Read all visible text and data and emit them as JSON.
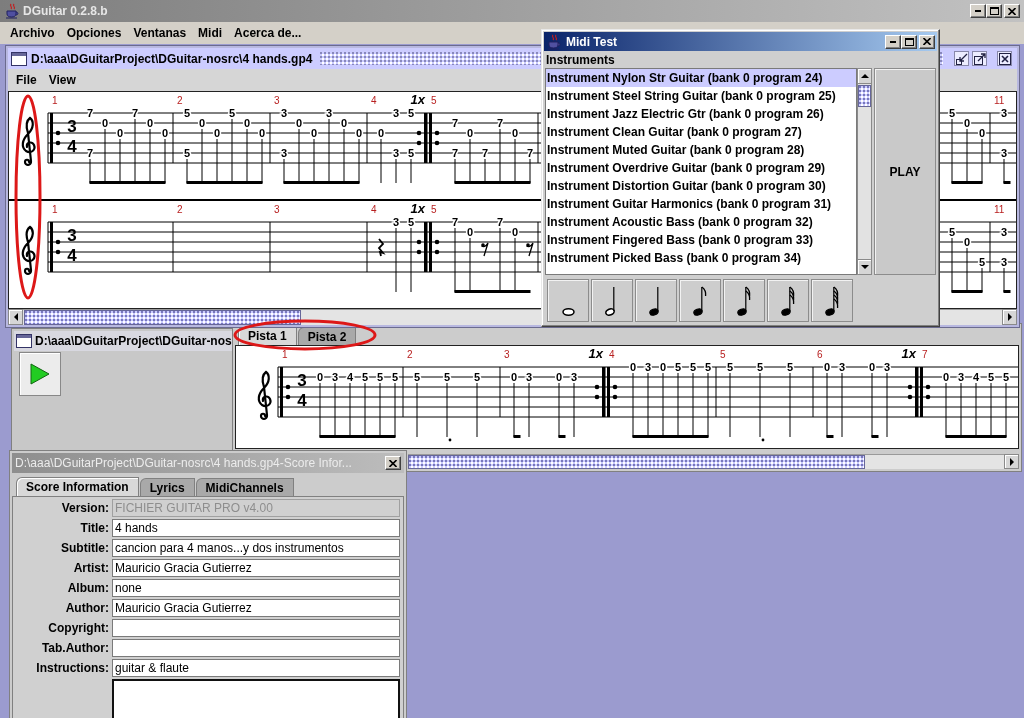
{
  "app_window": {
    "title": "DGuitar 0.2.8.b"
  },
  "menu_bar": [
    "Archivo",
    "Opciones",
    "Ventanas",
    "Midi",
    "Acerca de..."
  ],
  "score_window": {
    "title": "D:\\aaa\\DGuitarProject\\DGuitar-nosrc\\4 hands.gp4",
    "menu": [
      "File",
      "View"
    ],
    "tracks": [
      {
        "time_signature": [
          "3",
          "4"
        ],
        "measures": [
          {
            "number": "1",
            "repeat_open": true,
            "beats": [
              {
                "kind": "eighth-note",
                "frets": {
                  "s1": "7",
                  "s5": "7"
                }
              },
              {
                "kind": "eighth-note",
                "frets": {
                  "s2": "0"
                }
              },
              {
                "kind": "eighth-note",
                "frets": {
                  "s3": "0"
                }
              },
              {
                "kind": "eighth-note",
                "frets": {
                  "s1": "7"
                }
              },
              {
                "kind": "eighth-note",
                "frets": {
                  "s2": "0"
                }
              },
              {
                "kind": "eighth-note",
                "frets": {
                  "s3": "0"
                }
              }
            ]
          },
          {
            "number": "2",
            "beats": [
              {
                "kind": "eighth-note",
                "frets": {
                  "s1": "5",
                  "s5": "5"
                }
              },
              {
                "kind": "eighth-note",
                "frets": {
                  "s2": "0"
                }
              },
              {
                "kind": "eighth-note",
                "frets": {
                  "s3": "0"
                }
              },
              {
                "kind": "eighth-note",
                "frets": {
                  "s1": "5"
                }
              },
              {
                "kind": "eighth-note",
                "frets": {
                  "s2": "0"
                }
              },
              {
                "kind": "eighth-note",
                "frets": {
                  "s3": "0"
                }
              }
            ]
          },
          {
            "number": "3",
            "beats": [
              {
                "kind": "eighth-note",
                "frets": {
                  "s1": "3",
                  "s5": "3"
                }
              },
              {
                "kind": "eighth-note",
                "frets": {
                  "s2": "0"
                }
              },
              {
                "kind": "eighth-note",
                "frets": {
                  "s3": "0"
                }
              },
              {
                "kind": "eighth-note",
                "frets": {
                  "s1": "3"
                }
              },
              {
                "kind": "eighth-note",
                "frets": {
                  "s2": "0"
                }
              },
              {
                "kind": "eighth-note",
                "frets": {
                  "s3": "0"
                }
              }
            ]
          },
          {
            "number": "4",
            "repeat_close": "1x",
            "beats": [
              {
                "kind": "quarter-note",
                "frets": {
                  "s3": "0"
                }
              },
              {
                "kind": "quarter-note",
                "frets": {
                  "s1": "3",
                  "s5": "3"
                }
              },
              {
                "kind": "quarter-note",
                "frets": {
                  "s1": "5",
                  "s5": "5"
                }
              }
            ]
          },
          {
            "number": "5",
            "repeat_open": true,
            "beats": [
              {
                "kind": "eighth-note",
                "frets": {
                  "s2": "7",
                  "s5": "7"
                }
              },
              {
                "kind": "eighth-note",
                "frets": {
                  "s3": "0"
                }
              },
              {
                "kind": "eighth-note",
                "frets": {
                  "s5": "7"
                }
              },
              {
                "kind": "eighth-note",
                "frets": {
                  "s2": "7"
                }
              },
              {
                "kind": "eighth-note",
                "frets": {
                  "s3": "0"
                }
              },
              {
                "kind": "eighth-note",
                "frets": {
                  "s5": "7"
                }
              }
            ]
          }
        ],
        "tail": [
          {
            "beats": [
              {
                "kind": "eighth-note",
                "frets": {
                  "s1": "5"
                }
              },
              {
                "kind": "eighth-note",
                "frets": {
                  "s2": "0"
                }
              },
              {
                "kind": "eighth-note",
                "frets": {
                  "s3": "0"
                }
              }
            ]
          },
          {
            "number": "11",
            "beats": [
              {
                "kind": "eighth-note",
                "frets": {
                  "s1": "3",
                  "s5": "3"
                }
              }
            ]
          }
        ]
      },
      {
        "time_signature": [
          "3",
          "4"
        ],
        "measures": [
          {
            "number": "1",
            "repeat_open": true
          },
          {
            "number": "2"
          },
          {
            "number": "3"
          },
          {
            "number": "4",
            "repeat_close": "1x",
            "beats": [
              {
                "kind": "quarter-rest"
              },
              {
                "kind": "quarter-note",
                "frets": {
                  "s1": "3"
                }
              },
              {
                "kind": "quarter-note",
                "frets": {
                  "s1": "5"
                }
              }
            ]
          },
          {
            "number": "5",
            "repeat_open": true,
            "beats": [
              {
                "kind": "eighth-note",
                "frets": {
                  "s1": "7"
                }
              },
              {
                "kind": "eighth-note",
                "frets": {
                  "s2": "0"
                }
              },
              {
                "kind": "eighth-rest"
              },
              {
                "kind": "eighth-note",
                "frets": {
                  "s1": "7"
                }
              },
              {
                "kind": "eighth-note",
                "frets": {
                  "s2": "0"
                }
              },
              {
                "kind": "eighth-rest"
              }
            ]
          }
        ],
        "tail": [
          {
            "beats": [
              {
                "kind": "eighth-note",
                "frets": {
                  "s2": "5"
                }
              },
              {
                "kind": "eighth-note",
                "frets": {
                  "s3": "0"
                }
              },
              {
                "kind": "eighth-note",
                "frets": {
                  "s5": "5"
                }
              }
            ]
          },
          {
            "number": "11",
            "beats": [
              {
                "kind": "eighth-note",
                "frets": {
                  "s2": "3",
                  "s5": "3"
                }
              }
            ]
          }
        ]
      }
    ]
  },
  "midi_test": {
    "title": "Midi Test",
    "list_label": "Instruments",
    "instruments": [
      {
        "name": "Instrument Nylon Str Guitar (bank 0 program 24)",
        "selected": true
      },
      {
        "name": "Instrument Steel String Guitar (bank 0 program 25)",
        "selected": false
      },
      {
        "name": "Instrument Jazz Electric Gtr (bank 0 program 26)",
        "selected": false
      },
      {
        "name": "Instrument Clean Guitar (bank 0 program 27)",
        "selected": false
      },
      {
        "name": "Instrument Muted Guitar (bank 0 program 28)",
        "selected": false
      },
      {
        "name": "Instrument Overdrive Guitar (bank 0 program 29)",
        "selected": false
      },
      {
        "name": "Instrument Distortion Guitar (bank 0 program 30)",
        "selected": false
      },
      {
        "name": "Instrument Guitar Harmonics (bank 0 program 31)",
        "selected": false
      },
      {
        "name": "Instrument Acoustic Bass (bank 0 program 32)",
        "selected": false
      },
      {
        "name": "Instrument Fingered Bass (bank 0 program 33)",
        "selected": false
      },
      {
        "name": "Instrument Picked Bass (bank 0 program 34)",
        "selected": false
      }
    ],
    "play_button": "PLAY"
  },
  "player_window": {
    "title": "D:\\aaa\\DGuitarProject\\DGuitar-nos"
  },
  "track_view": {
    "tabs": [
      {
        "label": "Pista 1",
        "selected": true
      },
      {
        "label": "Pista 2",
        "selected": false
      }
    ],
    "time_signature": [
      "3",
      "4"
    ],
    "measures": [
      {
        "number": "1",
        "repeat_open": true,
        "beats": [
          {
            "kind": "eighth-note",
            "frets": {
              "s2": "0"
            }
          },
          {
            "kind": "eighth-note",
            "frets": {
              "s2": "3"
            }
          },
          {
            "kind": "eighth-note",
            "frets": {
              "s2": "4"
            }
          },
          {
            "kind": "eighth-note",
            "frets": {
              "s2": "5"
            }
          },
          {
            "kind": "eighth-note",
            "frets": {
              "s2": "5"
            }
          },
          {
            "kind": "eighth-note",
            "frets": {
              "s2": "5"
            }
          }
        ]
      },
      {
        "number": "2",
        "beats": [
          {
            "kind": "quarter-note",
            "frets": {
              "s2": "5"
            }
          },
          {
            "kind": "dotted-quarter-note",
            "frets": {
              "s2": "5"
            }
          },
          {
            "kind": "quarter-note",
            "frets": {
              "s2": "5"
            }
          }
        ]
      },
      {
        "number": "3",
        "repeat_close": "1x",
        "beats": [
          {
            "kind": "eighth-note",
            "frets": {
              "s2": "0"
            }
          },
          {
            "kind": "quarter-note",
            "frets": {
              "s2": "3"
            }
          },
          {
            "kind": "eighth-note",
            "frets": {
              "s2": "0"
            }
          },
          {
            "kind": "quarter-note",
            "frets": {
              "s2": "3"
            }
          }
        ]
      },
      {
        "number": "4",
        "repeat_open": true,
        "beats": [
          {
            "kind": "eighth-note",
            "frets": {
              "s1": "0"
            }
          },
          {
            "kind": "eighth-note",
            "frets": {
              "s1": "3"
            }
          },
          {
            "kind": "eighth-note",
            "frets": {
              "s1": "0"
            }
          },
          {
            "kind": "eighth-note",
            "frets": {
              "s1": "5"
            }
          },
          {
            "kind": "eighth-note",
            "frets": {
              "s1": "5"
            }
          },
          {
            "kind": "eighth-note",
            "frets": {
              "s1": "5"
            }
          }
        ]
      },
      {
        "number": "5",
        "beats": [
          {
            "kind": "quarter-note",
            "frets": {
              "s1": "5"
            }
          },
          {
            "kind": "dotted-quarter-note",
            "frets": {
              "s1": "5"
            }
          },
          {
            "kind": "quarter-note",
            "frets": {
              "s1": "5"
            }
          }
        ]
      },
      {
        "number": "6",
        "repeat_close": "1x",
        "beats": [
          {
            "kind": "eighth-note",
            "frets": {
              "s1": "0"
            }
          },
          {
            "kind": "quarter-note",
            "frets": {
              "s1": "3"
            }
          },
          {
            "kind": "eighth-note",
            "frets": {
              "s1": "0"
            }
          },
          {
            "kind": "quarter-note",
            "frets": {
              "s1": "3"
            }
          }
        ]
      },
      {
        "number": "7",
        "repeat_open": true,
        "beats": [
          {
            "kind": "eighth-note",
            "frets": {
              "s2": "0"
            }
          },
          {
            "kind": "eighth-note",
            "frets": {
              "s2": "3"
            }
          },
          {
            "kind": "eighth-note",
            "frets": {
              "s2": "4"
            }
          },
          {
            "kind": "eighth-note",
            "frets": {
              "s2": "5"
            }
          },
          {
            "kind": "eighth-note",
            "frets": {
              "s2": "5"
            }
          }
        ]
      }
    ]
  },
  "score_info": {
    "title": "D:\\aaa\\DGuitarProject\\DGuitar-nosrc\\4 hands.gp4-Score Infor...",
    "tabs": [
      {
        "label": "Score Information",
        "selected": true
      },
      {
        "label": "Lyrics",
        "selected": false
      },
      {
        "label": "MidiChannels",
        "selected": false
      }
    ],
    "fields": [
      {
        "label": "Version:",
        "value": "FICHIER GUITAR PRO v4.00",
        "disabled": true
      },
      {
        "label": "Title:",
        "value": "4 hands",
        "disabled": false
      },
      {
        "label": "Subtitle:",
        "value": "cancion para 4 manos...y dos instrumentos",
        "disabled": false
      },
      {
        "label": "Artist:",
        "value": "Mauricio Gracia Gutierrez",
        "disabled": false
      },
      {
        "label": "Album:",
        "value": "none",
        "disabled": false
      },
      {
        "label": "Author:",
        "value": "Mauricio Gracia Gutierrez",
        "disabled": false
      },
      {
        "label": "Copyright:",
        "disabled": false
      },
      {
        "label": "Tab.Author:",
        "disabled": false
      },
      {
        "label": "Instructions:",
        "value": "guitar & flaute",
        "disabled": false
      }
    ]
  }
}
